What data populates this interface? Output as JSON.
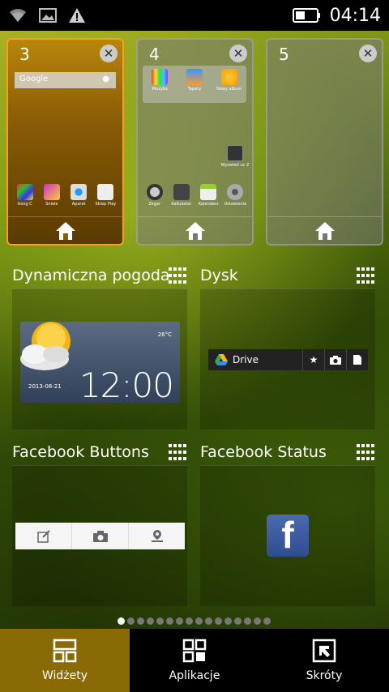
{
  "status": {
    "time": "04:14",
    "icons": [
      "wifi-icon",
      "image-icon",
      "warning-icon",
      "battery-icon"
    ]
  },
  "pages": [
    {
      "number": "3",
      "active": true
    },
    {
      "number": "4",
      "active": false
    },
    {
      "number": "5",
      "active": false
    }
  ],
  "page3": {
    "search_text": "Google",
    "apps": [
      "Goog C",
      "Sniele",
      "Aparat",
      "Sklep Play"
    ]
  },
  "page4": {
    "dock_apps": [
      "Muzyka",
      "Tapety",
      "Nowy album"
    ],
    "single_app": "Wyswietl uc Z",
    "apps": [
      "Zegar",
      "Kalkulator",
      "Kalendarz",
      "Ustawienia"
    ]
  },
  "widgets": {
    "weather": {
      "title": "Dynamiczna pogoda",
      "temp": "26°C",
      "time": "12:00",
      "date": "2013-08-21"
    },
    "drive": {
      "title": "Dysk",
      "label": "Drive"
    },
    "fb_buttons": {
      "title": "Facebook Buttons"
    },
    "fb_status": {
      "title": "Facebook Status",
      "logo": "f"
    }
  },
  "pager": {
    "count": 16,
    "active_index": 0
  },
  "tabs": [
    {
      "label": "Widżety",
      "icon": "widgets-icon",
      "active": true
    },
    {
      "label": "Aplikacje",
      "icon": "apps-grid-icon",
      "active": false
    },
    {
      "label": "Skróty",
      "icon": "shortcut-icon",
      "active": false
    }
  ],
  "colors": {
    "accent": "#f3a21a",
    "active_tab": "#8a6a05",
    "facebook": "#3b5998"
  }
}
